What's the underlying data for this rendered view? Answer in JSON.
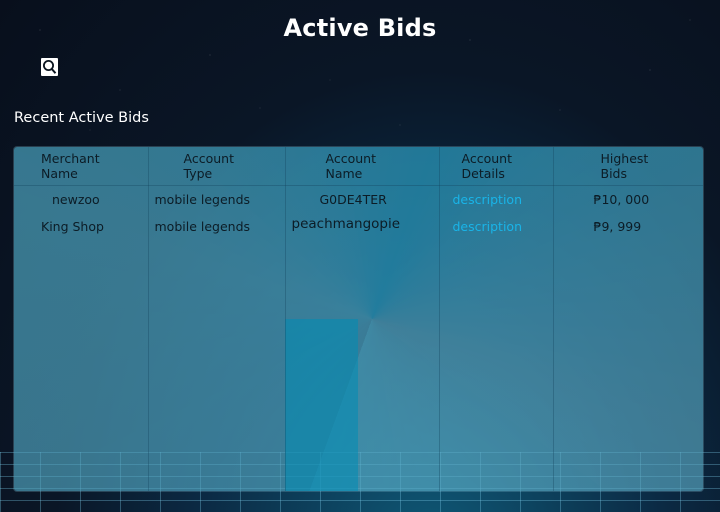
{
  "page": {
    "title": "Active Bids"
  },
  "search": {
    "icon": "search-icon"
  },
  "section": {
    "title": "Recent Active Bids"
  },
  "table": {
    "headers": [
      [
        "Merchant",
        "Name"
      ],
      [
        "Account",
        "Type"
      ],
      [
        "Account",
        "Name"
      ],
      [
        "Account",
        "Details"
      ],
      [
        "Highest",
        "Bids"
      ]
    ],
    "rows": [
      {
        "merchant": "newzoo",
        "type": "mobile legends",
        "account_name": "G0DE4TER",
        "details": "description",
        "bid": "₱10, 000"
      },
      {
        "merchant": "King Shop",
        "type": "mobile legends",
        "account_name": "peachmangopie",
        "details": "description",
        "bid": "₱9, 999"
      }
    ]
  },
  "colors": {
    "link": "#19b4e8",
    "panel": "#3c96b4",
    "background": "#0a1626"
  }
}
